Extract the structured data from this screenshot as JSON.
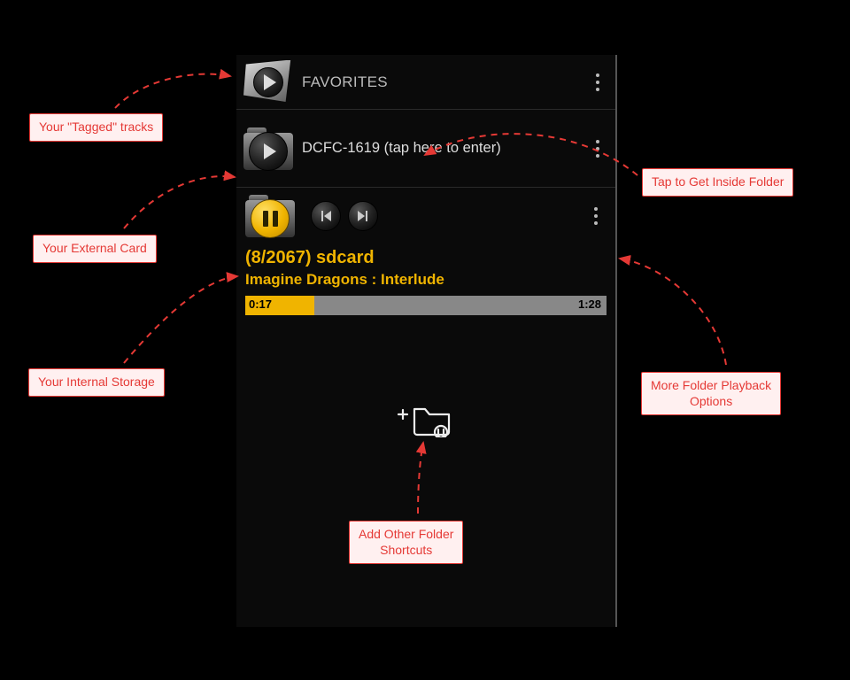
{
  "favorites": {
    "label": "FAVORITES"
  },
  "folder": {
    "label": "DCFC-1619 (tap here to enter)"
  },
  "player": {
    "counter": "(8/2067)  sdcard",
    "track": "Imagine Dragons : Interlude",
    "current": "0:17",
    "duration": "1:28"
  },
  "callouts": {
    "tagged": "Your \"Tagged\" tracks",
    "extcard": "Your External Card",
    "internal": "Your Internal Storage",
    "inside": "Tap to Get Inside Folder",
    "more": "More Folder Playback\nOptions",
    "addshort": "Add Other Folder\nShortcuts"
  }
}
